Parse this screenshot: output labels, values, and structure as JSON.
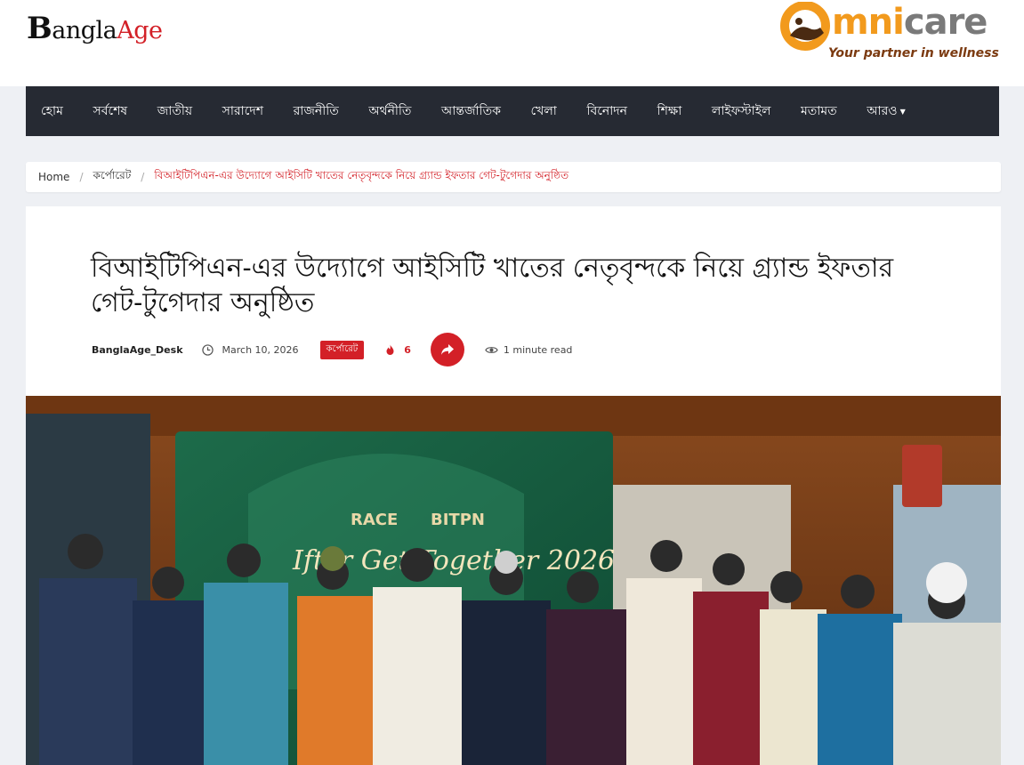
{
  "logo": {
    "part_b": "B",
    "part_angla": "angla",
    "part_age": "Age"
  },
  "ad": {
    "brand_mark": "O",
    "brand_mni": "mni",
    "brand_care": "care",
    "tagline": "Your partner in wellness"
  },
  "nav": [
    {
      "label": "হোম"
    },
    {
      "label": "সর্বশেষ"
    },
    {
      "label": "জাতীয়"
    },
    {
      "label": "সারাদেশ"
    },
    {
      "label": "রাজনীতি"
    },
    {
      "label": "অর্থনীতি"
    },
    {
      "label": "আন্তর্জাতিক"
    },
    {
      "label": "খেলা"
    },
    {
      "label": "বিনোদন"
    },
    {
      "label": "শিক্ষা"
    },
    {
      "label": "লাইফস্টাইল"
    },
    {
      "label": "মতামত"
    },
    {
      "label": "আরও"
    }
  ],
  "breadcrumb": {
    "home": "Home",
    "category": "কর্পোরেট",
    "current": "বিআইটিপিএন-এর উদ্যোগে আইসিটি খাতের নেতৃবৃন্দকে নিয়ে গ্র্যান্ড ইফতার গেট-টুগেদার অনুষ্ঠিত",
    "separator": "/"
  },
  "article": {
    "title": "বিআইটিপিএন-এর উদ্যোগে আইসিটি খাতের নেতৃবৃন্দকে নিয়ে গ্র্যান্ড ইফতার গেট-টুগেদার অনুষ্ঠিত",
    "author": "BanglaAge_Desk",
    "date": "March 10, 2026",
    "category": "কর্পোরেট",
    "hot_count": "6",
    "read_time": "1 minute read"
  },
  "photo": {
    "banner_brand_left": "RACE",
    "banner_brand_right": "BITPN",
    "banner_heading": "Iftar Get Together 2026"
  },
  "colors": {
    "accent": "#d32027",
    "nav_bg": "#262a33",
    "page_bg": "#eef0f4"
  }
}
